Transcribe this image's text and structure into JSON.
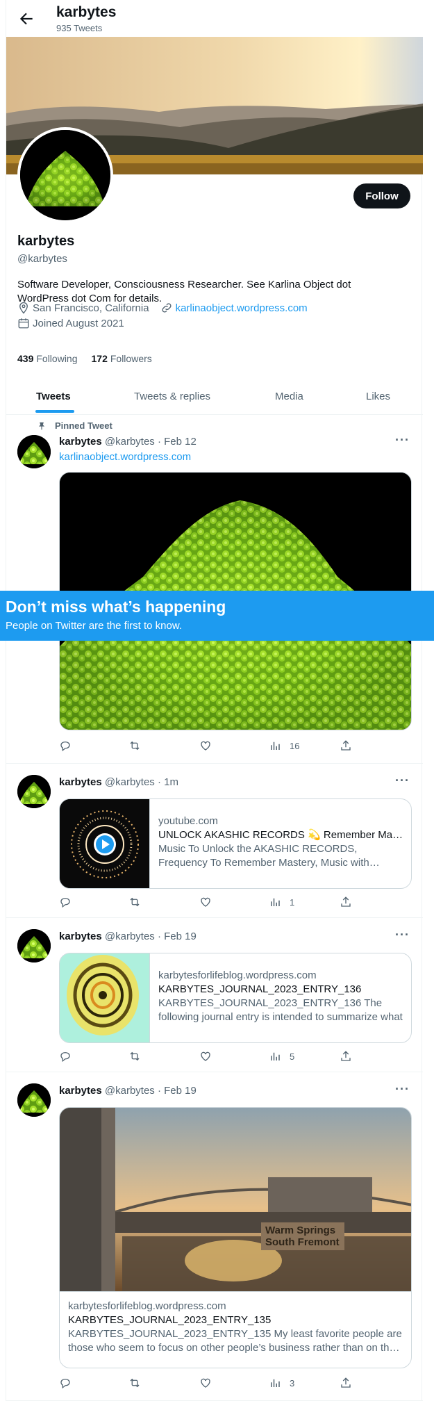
{
  "header": {
    "name": "karbytes",
    "tweet_count": "935 Tweets",
    "back_icon": "arrow-left-icon"
  },
  "profile": {
    "name": "karbytes",
    "handle": "@karbytes",
    "follow_label": "Follow",
    "bio": "Software Developer, Consciousness Researcher. See Karlina Object dot WordPress dot Com for details.",
    "location": "San Francisco, California",
    "website": "karlinaobject.wordpress.com",
    "joined": "Joined August 2021",
    "following_count": "439",
    "following_label": "Following",
    "followers_count": "172",
    "followers_label": "Followers"
  },
  "tabs": [
    {
      "label": "Tweets",
      "active": true
    },
    {
      "label": "Tweets & replies",
      "active": false
    },
    {
      "label": "Media",
      "active": false
    },
    {
      "label": "Likes",
      "active": false
    }
  ],
  "tweets": [
    {
      "pinned_label": "Pinned Tweet",
      "name": "karbytes",
      "meta": "@karbytes · Feb 12",
      "text_link": "karlinaobject.wordpress.com",
      "views": "16"
    },
    {
      "name": "karbytes",
      "meta": "@karbytes · 1m",
      "card": {
        "domain": "youtube.com",
        "title": "UNLOCK AKASHIC RECORDS 💫 Remember Mastery",
        "desc": "Music To Unlock the AKASHIC RECORDS, Frequency To Remember Mastery, Music with Healing"
      },
      "views": "1"
    },
    {
      "name": "karbytes",
      "meta": "@karbytes · Feb 19",
      "card": {
        "domain": "karbytesforlifeblog.wordpress.com",
        "title": "KARBYTES_JOURNAL_2023_ENTRY_136",
        "desc": "KARBYTES_JOURNAL_2023_ENTRY_136 The following journal entry is intended to summarize what"
      },
      "views": "5"
    },
    {
      "name": "karbytes",
      "meta": "@karbytes · Feb 19",
      "card": {
        "domain": "karbytesforlifeblog.wordpress.com",
        "title": "KARBYTES_JOURNAL_2023_ENTRY_135",
        "desc": "KARBYTES_JOURNAL_2023_ENTRY_135 My least favorite people are those who seem to focus on other people’s business rather than on their own"
      },
      "photo_sign": [
        "Warm Springs",
        "South Fremont"
      ],
      "views": "3"
    }
  ],
  "signup_banner": {
    "headline": "Don’t miss what’s happening",
    "subline": "People on Twitter are the first to know."
  },
  "colors": {
    "accent": "#1d9bf0",
    "text": "#0f1419",
    "muted": "#536471",
    "border": "#eff3f4"
  }
}
